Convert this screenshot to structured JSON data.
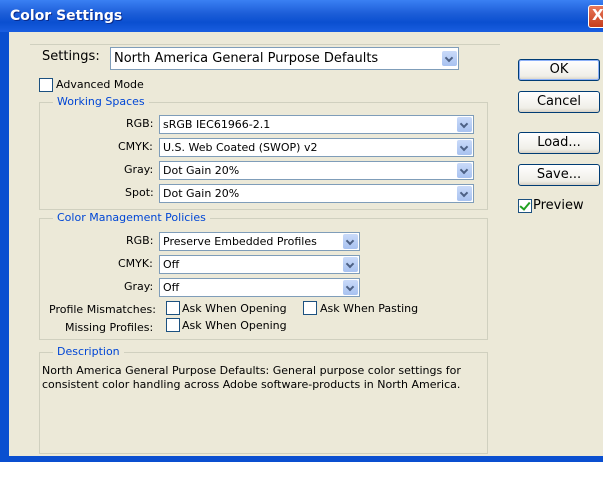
{
  "window": {
    "title": "Color Settings",
    "close_glyph": "X"
  },
  "settings": {
    "label": "Settings:",
    "value": "North America General Purpose Defaults"
  },
  "advanced_mode": {
    "label": "Advanced Mode",
    "checked": false
  },
  "working_spaces": {
    "legend": "Working Spaces",
    "rgb": {
      "label": "RGB:",
      "value": "sRGB IEC61966-2.1"
    },
    "cmyk": {
      "label": "CMYK:",
      "value": "U.S. Web Coated (SWOP) v2"
    },
    "gray": {
      "label": "Gray:",
      "value": "Dot Gain 20%"
    },
    "spot": {
      "label": "Spot:",
      "value": "Dot Gain 20%"
    }
  },
  "policies": {
    "legend": "Color Management Policies",
    "rgb": {
      "label": "RGB:",
      "value": "Preserve Embedded Profiles"
    },
    "cmyk": {
      "label": "CMYK:",
      "value": "Off"
    },
    "gray": {
      "label": "Gray:",
      "value": "Off"
    },
    "profile_mismatches": {
      "label": "Profile Mismatches:",
      "ask_opening": "Ask When Opening",
      "ask_pasting": "Ask When Pasting"
    },
    "missing_profiles": {
      "label": "Missing Profiles:",
      "ask_opening": "Ask When Opening"
    }
  },
  "description": {
    "legend": "Description",
    "line1": "North America General Purpose Defaults:  General purpose color settings for",
    "line2": "consistent color handling across Adobe software-products in North America."
  },
  "buttons": {
    "ok": "OK",
    "cancel": "Cancel",
    "load": "Load...",
    "save": "Save..."
  },
  "preview": {
    "label": "Preview",
    "checked": true
  },
  "colors": {
    "titlebar": "#0a4fd0",
    "dialog_bg": "#ece9d8",
    "legend_text": "#0046d5"
  }
}
